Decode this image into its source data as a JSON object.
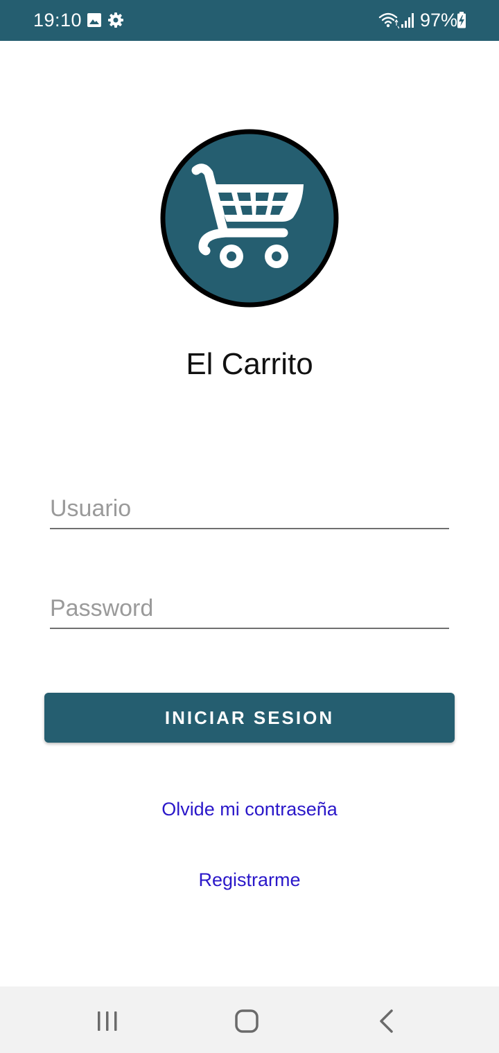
{
  "status_bar": {
    "time": "19:10",
    "battery": "97%",
    "icons": [
      "image-icon",
      "gear-icon",
      "wifi-icon",
      "signal-icon",
      "battery-charging-icon"
    ],
    "background_color": "#255e70"
  },
  "logo": {
    "icon": "shopping-cart-icon",
    "circle_color": "#255e70",
    "border_color": "#000000"
  },
  "app": {
    "title": "El Carrito"
  },
  "form": {
    "username_placeholder": "Usuario",
    "username_value": "",
    "password_placeholder": "Password",
    "password_value": "",
    "login_label": "INICIAR SESION",
    "button_color": "#255e70"
  },
  "links": {
    "forgot_password": "Olvide mi contraseña",
    "register": "Registrarme",
    "link_color": "#2a17c9"
  },
  "nav_bar": {
    "icons": [
      "recent-apps-icon",
      "home-icon",
      "back-icon"
    ]
  }
}
